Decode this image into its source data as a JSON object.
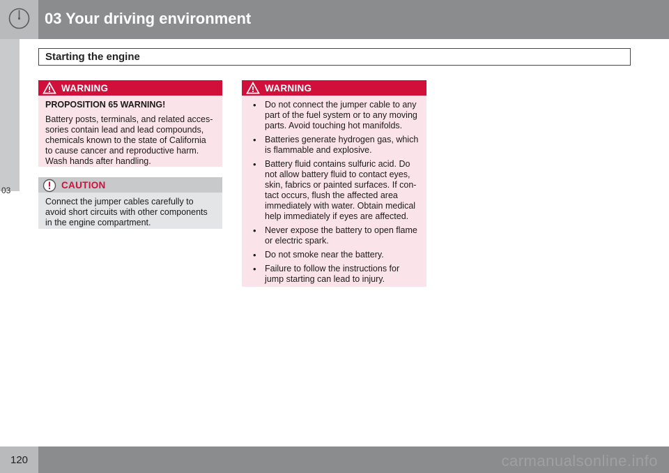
{
  "header": {
    "chapter_title": "03 Your driving environment",
    "icon": "gauge-icon"
  },
  "side_tab": {
    "label": "03"
  },
  "section": {
    "title": "Starting the engine"
  },
  "warning_left": {
    "label": "WARNING",
    "heading": "PROPOSITION 65 WARNING!",
    "body": "Battery posts, terminals, and related acces-sories contain lead and lead compounds, chemicals known to the state of California to cause cancer and reproductive harm. Wash hands after handling."
  },
  "caution": {
    "label": "CAUTION",
    "body": "Connect the jumper cables carefully to avoid short circuits with other components in the engine compartment."
  },
  "warning_right": {
    "label": "WARNING",
    "items": [
      "Do not connect the jumper cable to any part of the fuel system or to any moving parts. Avoid touching hot manifolds.",
      "Batteries generate hydrogen gas, which is flammable and explosive.",
      "Battery fluid contains sulfuric acid. Do not allow battery fluid to contact eyes, skin, fabrics or painted surfaces. If con-tact occurs, flush the affected area immediately with water. Obtain medical help immediately if eyes are affected.",
      "Never expose the battery to open flame or electric spark.",
      "Do not smoke near the battery.",
      "Failure to follow the instructions for jump starting can lead to injury."
    ]
  },
  "footer": {
    "page_number": "120",
    "watermark": "carmanualsonline.info"
  },
  "colors": {
    "warning_red": "#d0103a",
    "warning_bg": "#fbe3ea",
    "caution_bg": "#e4e5e6",
    "header_gray": "#8b8c8e"
  }
}
